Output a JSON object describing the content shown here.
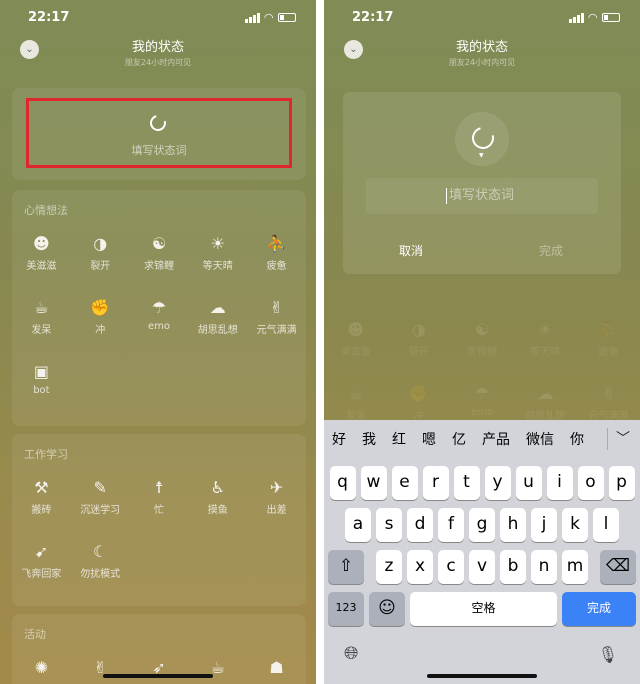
{
  "status": {
    "time": "22:17"
  },
  "header": {
    "title": "我的状态",
    "subtitle": "朋友24小时内可见"
  },
  "input": {
    "placeholder": "填写状态词"
  },
  "sections": [
    {
      "title": "心情想法",
      "items": [
        {
          "icon": "smile-icon",
          "glyph": "☻",
          "label": "美滋滋"
        },
        {
          "icon": "cracked-face-icon",
          "glyph": "◑",
          "label": "裂开"
        },
        {
          "icon": "koi-icon",
          "glyph": "☯",
          "label": "求锦鲤"
        },
        {
          "icon": "sun-icon",
          "glyph": "☀",
          "label": "等天晴"
        },
        {
          "icon": "tired-icon",
          "glyph": "⛹",
          "label": "疲惫"
        },
        {
          "icon": "daze-icon",
          "glyph": "☕",
          "label": "发呆"
        },
        {
          "icon": "rush-icon",
          "glyph": "✊",
          "label": "冲"
        },
        {
          "icon": "emo-icon",
          "glyph": "☂",
          "label": "emo"
        },
        {
          "icon": "thought-cloud-icon",
          "glyph": "☁",
          "label": "胡思乱想"
        },
        {
          "icon": "energetic-icon",
          "glyph": "✌",
          "label": "元气满满"
        },
        {
          "icon": "robot-icon",
          "glyph": "▣",
          "label": "bot"
        }
      ]
    },
    {
      "title": "工作学习",
      "items": [
        {
          "icon": "brick-icon",
          "glyph": "⚒",
          "label": "搬砖"
        },
        {
          "icon": "study-icon",
          "glyph": "✎",
          "label": "沉迷学习"
        },
        {
          "icon": "busy-icon",
          "glyph": "☨",
          "label": "忙"
        },
        {
          "icon": "slacking-icon",
          "glyph": "♿",
          "label": "摸鱼"
        },
        {
          "icon": "airplane-icon",
          "glyph": "✈",
          "label": "出差"
        },
        {
          "icon": "run-home-icon",
          "glyph": "➹",
          "label": "飞奔回家"
        },
        {
          "icon": "moon-icon",
          "glyph": "☾",
          "label": "勿扰模式"
        }
      ]
    },
    {
      "title": "活动",
      "items": [
        {
          "icon": "jump-icon",
          "glyph": "✺",
          "label": ""
        },
        {
          "icon": "peace-icon",
          "glyph": "✌",
          "label": ""
        },
        {
          "icon": "running-icon",
          "glyph": "➶",
          "label": ""
        },
        {
          "icon": "coffee-icon",
          "glyph": "☕",
          "label": ""
        },
        {
          "icon": "milk-tea-icon",
          "glyph": "☗",
          "label": ""
        }
      ]
    }
  ],
  "dialog": {
    "placeholder": "填写状态词",
    "cancel": "取消",
    "done": "完成"
  },
  "keyboard": {
    "candidates": [
      "好",
      "我",
      "红",
      "嗯",
      "亿",
      "产品",
      "微信",
      "你"
    ],
    "rows": [
      [
        "q",
        "w",
        "e",
        "r",
        "t",
        "y",
        "u",
        "i",
        "o",
        "p"
      ],
      [
        "a",
        "s",
        "d",
        "f",
        "g",
        "h",
        "j",
        "k",
        "l"
      ],
      [
        "z",
        "x",
        "c",
        "v",
        "b",
        "n",
        "m"
      ]
    ],
    "numbers": "123",
    "space": "空格",
    "confirm": "完成"
  },
  "colors": {
    "highlight": "#e0262e",
    "confirm": "#3b82f6"
  }
}
